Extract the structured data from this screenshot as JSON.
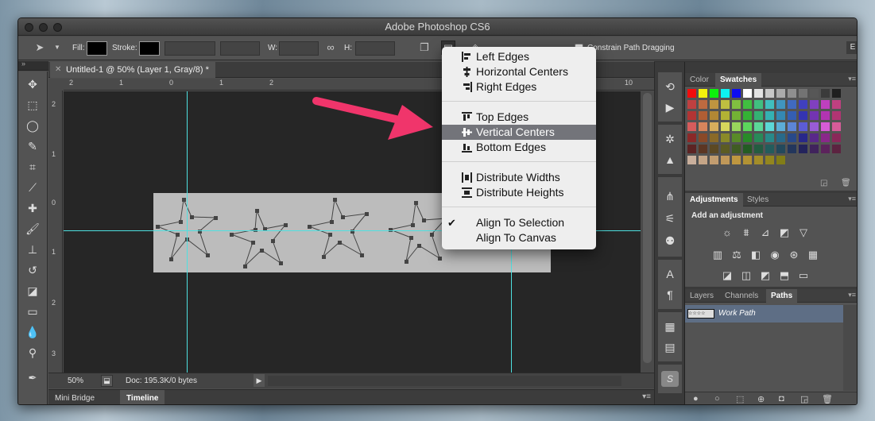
{
  "app": {
    "title": "Adobe Photoshop CS6"
  },
  "options_bar": {
    "fill_label": "Fill:",
    "stroke_label": "Stroke:",
    "w_label": "W:",
    "h_label": "H:",
    "constrain_label": "Constrain Path Dragging",
    "overflow_label": "E"
  },
  "document_tab": {
    "title": "Untitled-1 @ 50% (Layer 1, Gray/8) *"
  },
  "ruler": {
    "h_ticks": [
      "2",
      "1",
      "0",
      "1",
      "2",
      "10"
    ],
    "v_ticks": [
      "2",
      "1",
      "0",
      "1",
      "2",
      "3"
    ]
  },
  "status": {
    "zoom": "50%",
    "doc_info": "Doc: 195.3K/0 bytes"
  },
  "bottom_tabs": [
    {
      "label": "Mini Bridge"
    },
    {
      "label": "Timeline"
    }
  ],
  "align_menu": {
    "items": [
      {
        "label": "Left Edges",
        "icon": "align-left-edges-icon"
      },
      {
        "label": "Horizontal Centers",
        "icon": "align-horizontal-centers-icon"
      },
      {
        "label": "Right Edges",
        "icon": "align-right-edges-icon"
      },
      {
        "label": "Top Edges",
        "icon": "align-top-edges-icon"
      },
      {
        "label": "Vertical Centers",
        "icon": "align-vertical-centers-icon",
        "highlighted": true
      },
      {
        "label": "Bottom Edges",
        "icon": "align-bottom-edges-icon"
      },
      {
        "label": "Distribute Widths",
        "icon": "distribute-widths-icon"
      },
      {
        "label": "Distribute Heights",
        "icon": "distribute-heights-icon"
      },
      {
        "label": "Align To Selection",
        "checked": true
      },
      {
        "label": "Align To Canvas",
        "checked": false
      }
    ]
  },
  "panels": {
    "color_swatches": {
      "tabs": [
        "Color",
        "Swatches"
      ],
      "active": "Swatches"
    },
    "adjustments": {
      "tabs": [
        "Adjustments",
        "Styles"
      ],
      "heading": "Add an adjustment"
    },
    "layers": {
      "tabs": [
        "Layers",
        "Channels",
        "Paths"
      ],
      "active": "Paths",
      "paths": [
        {
          "name": "Work Path"
        }
      ]
    }
  },
  "colors": {
    "accent_arrow": "#f0356b",
    "guide": "#4ee0e0",
    "menu_highlight": "#73747a",
    "selected_path": "#5e6e85"
  }
}
